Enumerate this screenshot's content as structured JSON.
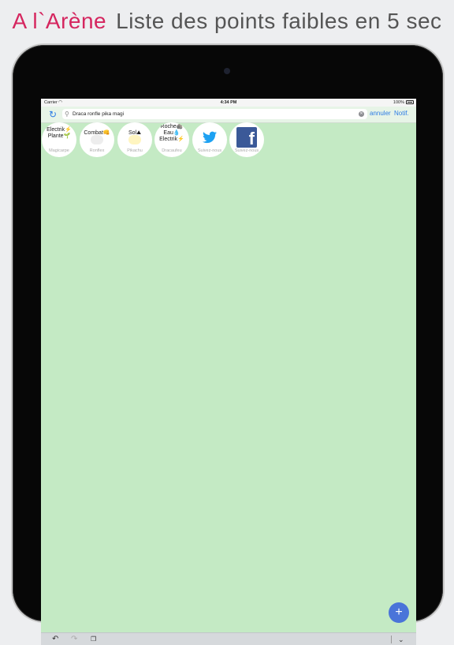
{
  "headline": {
    "brand": "A l`Arène",
    "subtitle": "Liste des points faibles en 5 sec"
  },
  "statusbar": {
    "carrier": "Carrier",
    "wifi_icon": "wifi-icon",
    "time": "4:34 PM",
    "battery_percent": "100%"
  },
  "navbar": {
    "reload_icon": "reload-icon",
    "search_value": "Draca ronfle pika magi",
    "cancel_label": "annuler",
    "notif_label": "Notif."
  },
  "bubbles": [
    {
      "types": "Electrik⚡\nPlante🌱",
      "name": "Magicarpe"
    },
    {
      "types": "Combat👊",
      "name": "Ronflex"
    },
    {
      "types": "Sol⛰",
      "name": "Pikachu"
    },
    {
      "types": "Roche🪨\nEau💧\nElectrik⚡",
      "name": "Dracaufeu"
    },
    {
      "types": "",
      "name": "Suivez-nous",
      "icon": "twitter-icon"
    },
    {
      "types": "",
      "name": "Suivez-nous",
      "icon": "facebook-icon"
    }
  ],
  "fab_label": "+",
  "toolbar": {
    "undo_icon": "undo-icon",
    "redo_icon": "redo-icon",
    "paste_icon": "paste-icon",
    "keyboard_dismiss_icon": "chevron-down-icon"
  },
  "colors": {
    "brand": "#d5265f",
    "screen_bg": "#c4eac4",
    "accent": "#2c7be5",
    "fab": "#4a74d9"
  }
}
